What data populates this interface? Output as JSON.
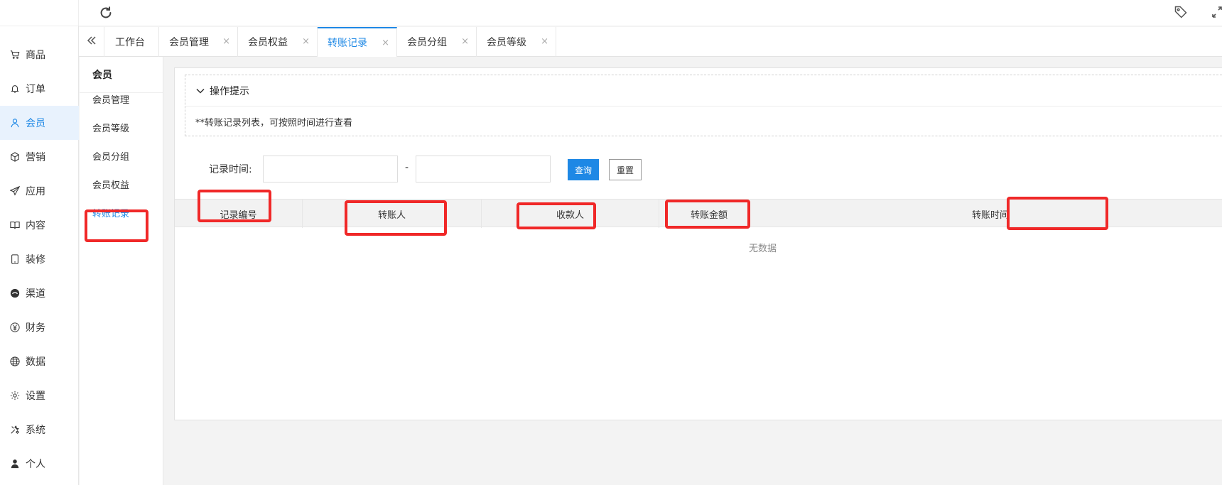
{
  "sidebar": {
    "items": [
      {
        "label": "商品",
        "icon": "cart-icon"
      },
      {
        "label": "订单",
        "icon": "bell-icon"
      },
      {
        "label": "会员",
        "icon": "user-icon",
        "active": true
      },
      {
        "label": "营销",
        "icon": "cube-icon"
      },
      {
        "label": "应用",
        "icon": "paper-plane-icon"
      },
      {
        "label": "内容",
        "icon": "book-icon"
      },
      {
        "label": "装修",
        "icon": "tablet-icon"
      },
      {
        "label": "渠道",
        "icon": "chat-icon"
      },
      {
        "label": "财务",
        "icon": "yen-icon"
      },
      {
        "label": "数据",
        "icon": "globe-icon"
      },
      {
        "label": "设置",
        "icon": "gear-icon"
      },
      {
        "label": "系统",
        "icon": "tools-icon"
      },
      {
        "label": "个人",
        "icon": "person-icon"
      }
    ]
  },
  "tabs": [
    {
      "label": "工作台",
      "closable": false
    },
    {
      "label": "会员管理",
      "closable": true
    },
    {
      "label": "会员权益",
      "closable": true
    },
    {
      "label": "转账记录",
      "closable": true,
      "active": true
    },
    {
      "label": "会员分组",
      "closable": true
    },
    {
      "label": "会员等级",
      "closable": true
    }
  ],
  "tab_close_glyph": "×",
  "subsidebar": {
    "title": "会员",
    "items": [
      "会员管理",
      "会员等级",
      "会员分组",
      "会员权益",
      "转账记录"
    ],
    "active_index": 4
  },
  "tips": {
    "title": "操作提示",
    "body": "**转账记录列表，可按照时间进行查看"
  },
  "filter": {
    "label": "记录时间:",
    "start_value": "",
    "end_value": "",
    "separator": "-",
    "query_label": "查询",
    "reset_label": "重置"
  },
  "table": {
    "columns": [
      "记录编号",
      "转账人",
      "收款人",
      "转账金额",
      "转账时间"
    ],
    "empty_text": "无数据"
  },
  "colors": {
    "accent": "#1e88e5",
    "annotation": "#f02828"
  }
}
